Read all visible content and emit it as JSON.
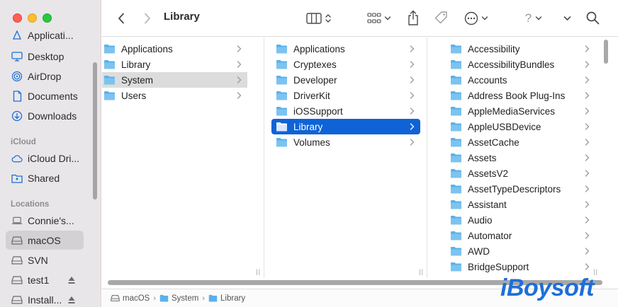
{
  "window": {
    "title": "Library"
  },
  "sidebar": {
    "favorites": [
      {
        "label": "Applicati...",
        "icon": "applications-icon"
      },
      {
        "label": "Desktop",
        "icon": "desktop-icon"
      },
      {
        "label": "AirDrop",
        "icon": "airdrop-icon"
      },
      {
        "label": "Documents",
        "icon": "document-icon"
      },
      {
        "label": "Downloads",
        "icon": "download-icon"
      }
    ],
    "icloud_heading": "iCloud",
    "icloud": [
      {
        "label": "iCloud Dri...",
        "icon": "icloud-icon"
      },
      {
        "label": "Shared",
        "icon": "shared-folder-icon"
      }
    ],
    "locations_heading": "Locations",
    "locations": [
      {
        "label": "Connie's...",
        "icon": "laptop-icon"
      },
      {
        "label": "macOS",
        "icon": "disk-icon",
        "selected": true
      },
      {
        "label": "SVN",
        "icon": "disk-icon"
      },
      {
        "label": "test1",
        "icon": "disk-icon",
        "eject": true
      },
      {
        "label": "Install...",
        "icon": "disk-icon",
        "eject": true
      }
    ]
  },
  "columns": [
    {
      "items": [
        {
          "label": "Applications"
        },
        {
          "label": "Library"
        },
        {
          "label": "System",
          "selected": "grey"
        },
        {
          "label": "Users"
        }
      ]
    },
    {
      "items": [
        {
          "label": "Applications"
        },
        {
          "label": "Cryptexes"
        },
        {
          "label": "Developer"
        },
        {
          "label": "DriverKit"
        },
        {
          "label": "iOSSupport"
        },
        {
          "label": "Library",
          "selected": "blue"
        },
        {
          "label": "Volumes"
        }
      ]
    },
    {
      "items": [
        {
          "label": "Accessibility"
        },
        {
          "label": "AccessibilityBundles"
        },
        {
          "label": "Accounts"
        },
        {
          "label": "Address Book Plug-Ins"
        },
        {
          "label": "AppleMediaServices"
        },
        {
          "label": "AppleUSBDevice"
        },
        {
          "label": "AssetCache"
        },
        {
          "label": "Assets"
        },
        {
          "label": "AssetsV2"
        },
        {
          "label": "AssetTypeDescriptors"
        },
        {
          "label": "Assistant"
        },
        {
          "label": "Audio"
        },
        {
          "label": "Automator"
        },
        {
          "label": "AWD"
        },
        {
          "label": "BridgeSupport"
        }
      ]
    }
  ],
  "pathbar": {
    "segments": [
      {
        "label": "macOS",
        "icon": "disk-icon"
      },
      {
        "label": "System",
        "icon": "folder-icon"
      },
      {
        "label": "Library",
        "icon": "folder-icon"
      }
    ],
    "separator": "›"
  },
  "toolbar": {
    "help_label": "?"
  },
  "watermark": "iBoysoft",
  "colors": {
    "sidebar_bg": "#e9e6e9",
    "selection_blue": "#0f63d6",
    "folder_blue": "#5ab1ea"
  }
}
